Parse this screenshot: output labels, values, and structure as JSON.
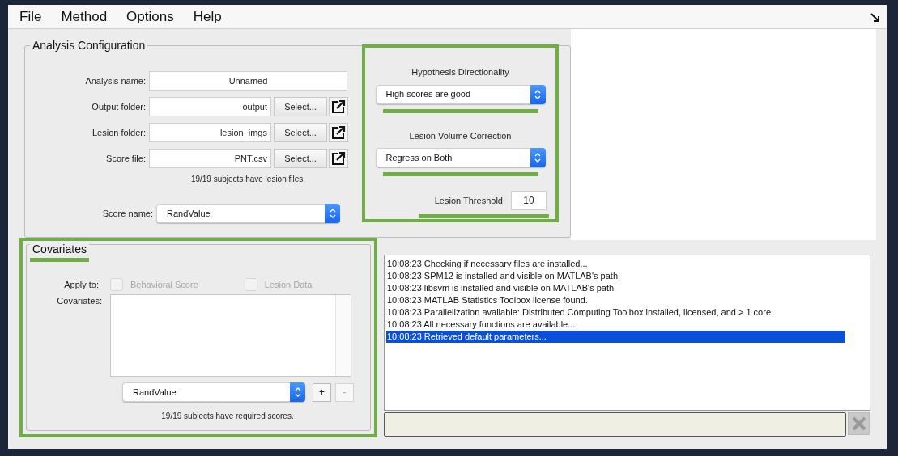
{
  "menu": [
    "File",
    "Method",
    "Options",
    "Help"
  ],
  "analysis_configuration": {
    "title": "Analysis Configuration",
    "fields": [
      {
        "kind": "text",
        "label": "Analysis name:",
        "value": "Unnamed"
      },
      {
        "kind": "path",
        "label": "Output folder:",
        "value": "output",
        "button": "Select..."
      },
      {
        "kind": "path",
        "label": "Lesion folder:",
        "value": "lesion_imgs",
        "button": "Select..."
      },
      {
        "kind": "path",
        "label": "Score file:",
        "value": "PNT.csv",
        "button": "Select..."
      }
    ],
    "status": "19/19 subjects have lesion files.",
    "score_name": {
      "label": "Score name:",
      "value": "RandValue"
    }
  },
  "model_options": {
    "highlighted": true,
    "directionality": {
      "label": "Hypothesis Directionality",
      "value": "High scores are good",
      "underlined": true
    },
    "volume_correction": {
      "label": "Lesion Volume Correction",
      "value": "Regress on Both",
      "underlined": true
    },
    "threshold": {
      "label": "Lesion Threshold:",
      "value": "10",
      "underlined": true
    }
  },
  "covariates": {
    "highlighted": true,
    "title": "Covariates",
    "title_underlined": true,
    "apply_to_label": "Apply to:",
    "apply_to": [
      {
        "label": "Behavioral Score",
        "checked": false,
        "disabled": true
      },
      {
        "label": "Lesion Data",
        "checked": false,
        "disabled": true
      }
    ],
    "list_label": "Covariates:",
    "selector": "RandValue",
    "add_button": {
      "label": "+",
      "disabled": false
    },
    "remove_button": {
      "label": "-",
      "disabled": true
    },
    "status": "19/19 subjects have required scores."
  },
  "log": {
    "lines": [
      {
        "text": "10:08:23 Checking if necessary files are installed...",
        "selected": false
      },
      {
        "text": "10:08:23 SPM12 is installed and visible on MATLAB's path.",
        "selected": false
      },
      {
        "text": "10:08:23 libsvm is installed and visible on MATLAB's path.",
        "selected": false
      },
      {
        "text": "10:08:23 MATLAB Statistics Toolbox license found.",
        "selected": false
      },
      {
        "text": "10:08:23 Parallelization available: Distributed Computing Toolbox installed, licensed, and > 1 core.",
        "selected": false
      },
      {
        "text": "10:08:23 All necessary functions are available...",
        "selected": false
      },
      {
        "text": "10:08:23 Retrieved default parameters...",
        "selected": true
      }
    ]
  },
  "command": {
    "clear_disabled": true
  }
}
